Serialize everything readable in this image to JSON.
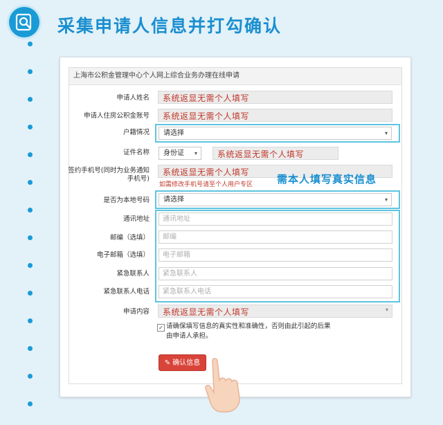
{
  "header": {
    "title": "采集申请人信息并打勾确认"
  },
  "form": {
    "panel_title": "上海市公积金管理中心个人网上综合业务办理在线申请",
    "system_fill_text": "系统返显无需个人填写",
    "labels": {
      "name": "申请人姓名",
      "account": "申请人住房公积金账号",
      "hukou": "户籍情况",
      "id_name": "证件名称",
      "phone": "签约手机号(同时为业务通知手机号)",
      "is_own": "是否为本地号码",
      "address": "通讯地址",
      "zip": "邮编（选填）",
      "email": "电子邮箱（选填）",
      "contact": "紧急联系人",
      "contact_phone": "紧急联系人电话",
      "content": "申请内容"
    },
    "hukou_select": "请选择",
    "id_type_select": "身份证",
    "phone_note": "如需修改手机号请至个人用户专区",
    "is_own_select": "请选择",
    "placeholders": {
      "address": "通讯地址",
      "zip": "邮编",
      "email": "电子邮箱",
      "contact": "紧急联系人",
      "contact_phone": "紧急联系人电话"
    },
    "agree_text": "请确保填写信息的真实性和准确性，否则由此引起的后果由申请人承担。",
    "agree_checked": true,
    "confirm_label": "确认信息"
  },
  "annotation": {
    "text": "需本人填写真实信息"
  },
  "colors": {
    "accent": "#1a8fd0",
    "highlight": "#5ec4e2",
    "system_text": "#c0392b",
    "button": "#d9443a"
  }
}
